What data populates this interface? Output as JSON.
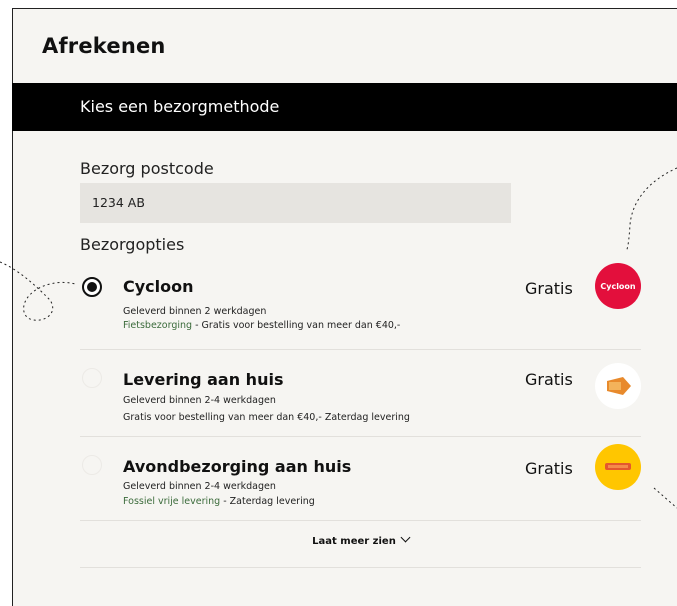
{
  "header": {
    "title": "Afrekenen"
  },
  "delivery_bar": {
    "label": "Kies een bezorgmethode"
  },
  "postcode": {
    "label": "Bezorg postcode",
    "value": "1234 AB"
  },
  "options_label": "Bezorgopties",
  "options": [
    {
      "title": "Cycloon",
      "selected": true,
      "line1": "Geleverd binnen 2 werkdagen",
      "line2_highlight": "Fietsbezorging",
      "line2_rest": " - Gratis voor bestelling van meer dan €40,-",
      "price": "Gratis",
      "logo_text": "Cycloon",
      "logo_color": "#e30f3c"
    },
    {
      "title": "Levering aan huis",
      "selected": false,
      "line1": "Geleverd binnen 2-4 werkdagen",
      "line2_highlight": "",
      "line2_rest": "Gratis voor bestelling van meer dan €40,- Zaterdag levering",
      "price": "Gratis",
      "logo_color": "#e88a2c"
    },
    {
      "title": "Avondbezorging aan huis",
      "selected": false,
      "line1": "Geleverd binnen 2-4 werkdagen",
      "line2_highlight": "Fossiel vrije levering",
      "line2_rest": " - Zaterdag levering",
      "price": "Gratis",
      "logo_color": "#ffc600"
    }
  ],
  "show_more": {
    "label": "Laat meer zien"
  }
}
